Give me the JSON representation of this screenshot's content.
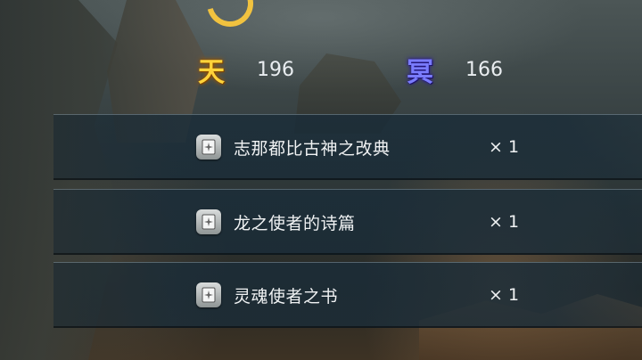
{
  "currencies": [
    {
      "glyph": "天",
      "value": "196",
      "color": "#ffd33a"
    },
    {
      "glyph": "冥",
      "value": "166",
      "color": "#7a7cff"
    }
  ],
  "rewards": [
    {
      "name": "志那都比古神之改典",
      "quantity": "× 1",
      "icon": "book-icon"
    },
    {
      "name": "龙之使者的诗篇",
      "quantity": "× 1",
      "icon": "book-icon"
    },
    {
      "name": "灵魂使者之书",
      "quantity": "× 1",
      "icon": "book-icon"
    }
  ]
}
